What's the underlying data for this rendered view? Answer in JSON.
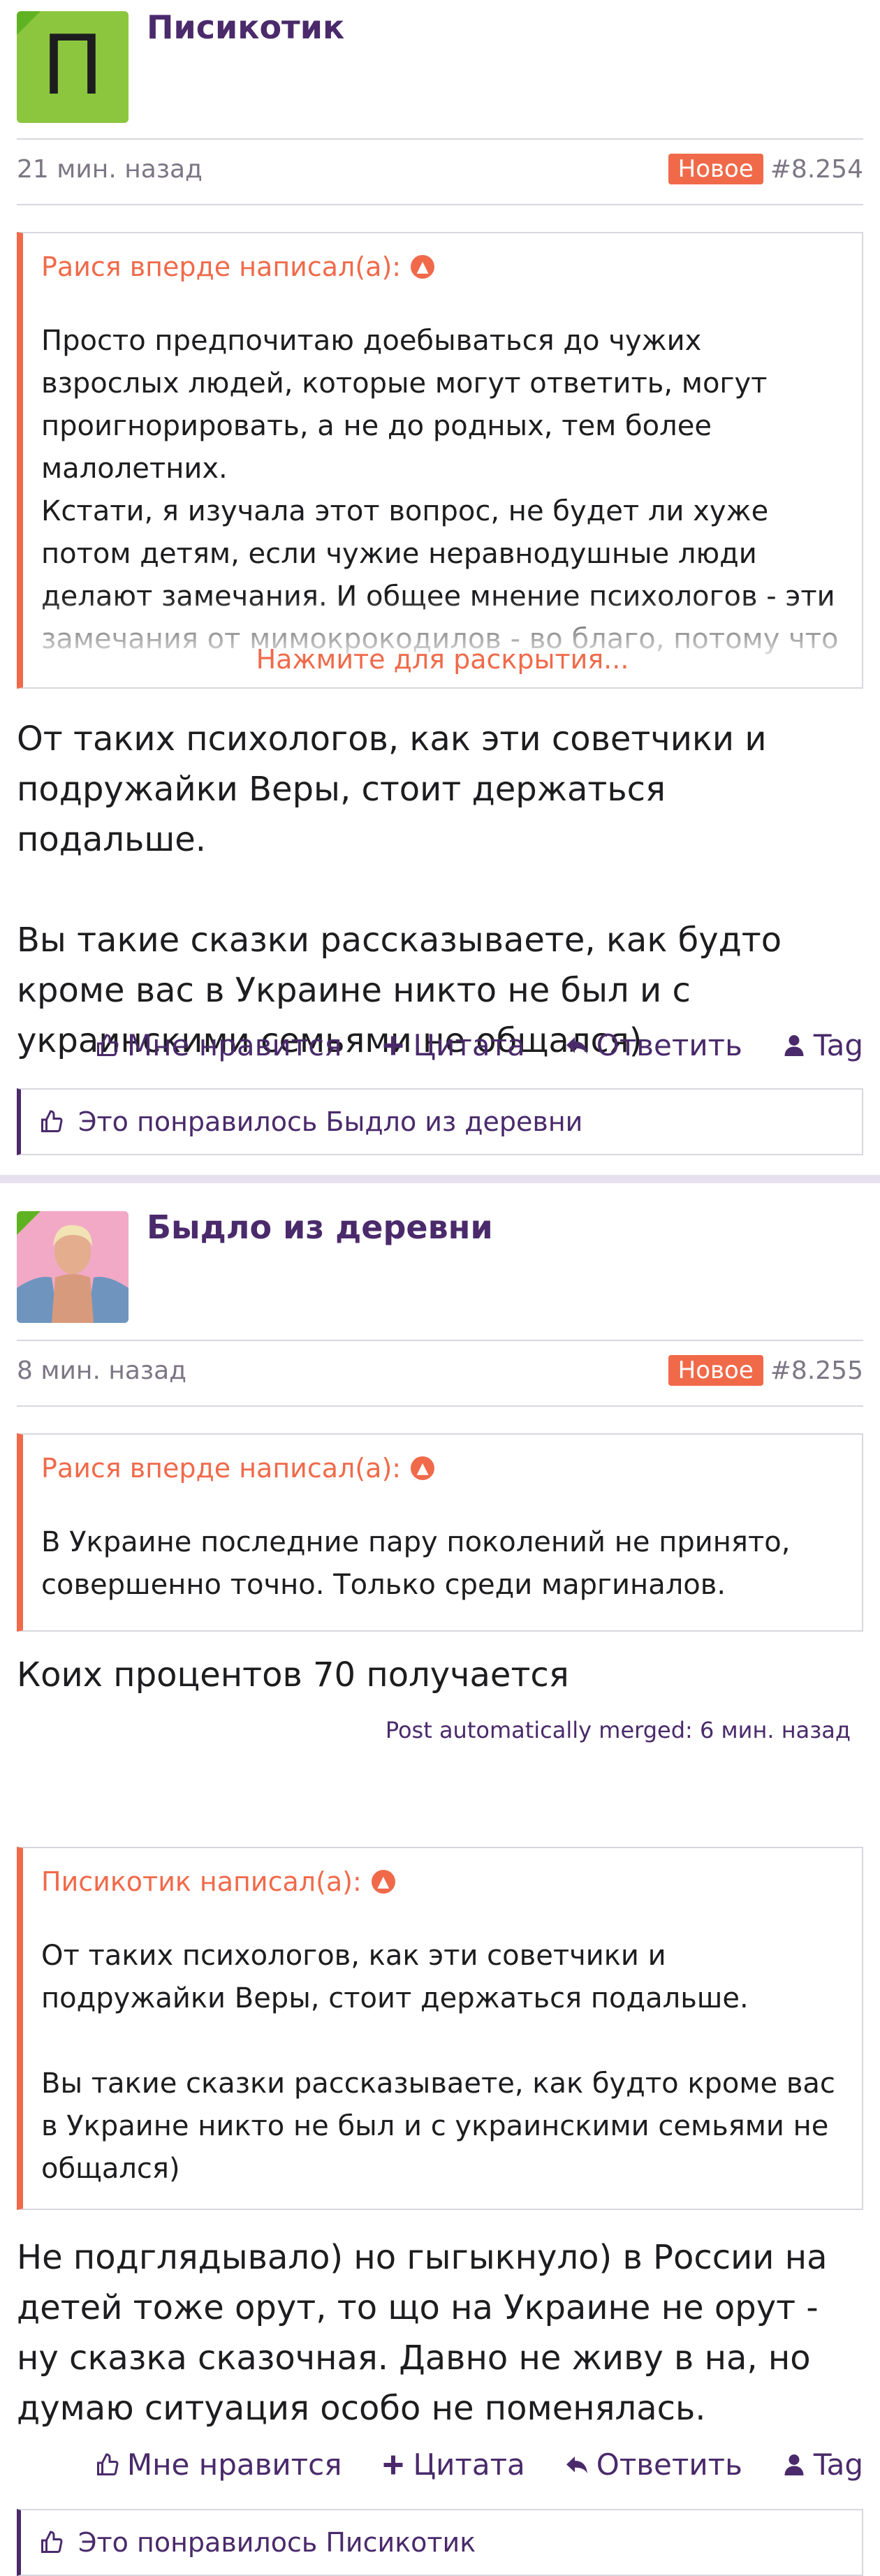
{
  "colors": {
    "accent": "#f06a4a",
    "brand": "#4a2a6b",
    "badge": "#f06a4a"
  },
  "posts": [
    {
      "username": "Писикотик",
      "avatar_letter": "П",
      "time": "21 мин. назад",
      "badge": "Новое",
      "post_number": "#8.254",
      "quote": {
        "author_label": "Раися вперде написал(а):",
        "text": "Просто предпочитаю доебываться до чужих взрослых людей, которые могут ответить, могут проигнорировать, а не до родных, тем более малолетних.\nКстати, я изучала этот вопрос, не будет ли хуже потом детям, если чужие неравнодушные люди делают замечания. И общее мнение психологов - эти замечания от мимокрокодилов - во благо, потому что",
        "expand_label": "Нажмите для раскрытия..."
      },
      "body": "От таких психологов, как эти советчики и подружайки Веры, стоит держаться подальше.\n\nВы такие сказки рассказываете, как будто кроме вас в Украине никто не был и с украинскими семьями не общался)",
      "actions": {
        "like": "Мне нравится",
        "quote": "Цитата",
        "reply": "Ответить",
        "tag": "Tag"
      },
      "likes_text": "Это понравилось Быдло из деревни"
    },
    {
      "username": "Быдло из деревни",
      "time": "8 мин. назад",
      "badge": "Новое",
      "post_number": "#8.255",
      "quote": {
        "author_label": "Раися вперде написал(а):",
        "text": "В Украине последние пару поколений не принято, совершенно точно. Только среди маргиналов."
      },
      "body": "Коих процентов 70 получается",
      "merged": "Post automatically merged: 6 мин. назад",
      "quote2": {
        "author_label": "Писикотик написал(а):",
        "text": "От таких психологов, как эти советчики и подружайки Веры, стоит держаться подальше.\n\nВы такие сказки рассказываете, как будто кроме вас в Украине никто не был и с украинскими семьями не общался)"
      },
      "body2": "Не подглядывало) но гыгыкнуло) в России на детей тоже орут, то що на Украине не орут - ну сказка сказочная. Давно не живу в на, но думаю ситуация особо не поменялась.",
      "actions": {
        "like": "Мне нравится",
        "quote": "Цитата",
        "reply": "Ответить",
        "tag": "Tag"
      },
      "likes_text": "Это понравилось Писикотик"
    }
  ]
}
